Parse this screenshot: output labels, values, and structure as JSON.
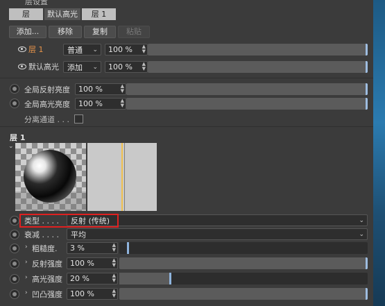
{
  "header": {
    "title": "层设置"
  },
  "tabs": [
    {
      "label": "层",
      "active": true
    },
    {
      "label": "默认高光",
      "active": false
    },
    {
      "label": "层 1",
      "active": true
    }
  ],
  "toolbar": {
    "add": "添加...",
    "remove": "移除",
    "copy": "复制",
    "paste": "粘贴"
  },
  "layers": [
    {
      "name": "层 1",
      "blend": "普通",
      "opacity": "100 %",
      "name_color": "#e8944a"
    },
    {
      "name": "默认高光",
      "blend": "添加",
      "opacity": "100 %",
      "name_color": "#d6d6d6"
    }
  ],
  "global": {
    "reflect_label": "全局反射亮度",
    "reflect_value": "100 %",
    "specular_label": "全局高光亮度",
    "specular_value": "100 %",
    "separate_label": "分离通道 . . ."
  },
  "section": {
    "title": "层 1"
  },
  "props": {
    "type_label": "类型 . . . .",
    "type_value": "反射 (传统)",
    "falloff_label": "衰减 . . . .",
    "falloff_value": "平均",
    "roughness_label": "粗糙度.",
    "roughness_value": "3 %",
    "roughness_fraction": 0.03,
    "reflect_label": "反射强度",
    "reflect_value": "100 %",
    "reflect_fraction": 1.0,
    "spec_label": "高光强度",
    "spec_value": "20 %",
    "spec_fraction": 0.2,
    "bump_label": "凹凸强度",
    "bump_value": "100 %",
    "bump_fraction": 1.0
  },
  "icons": {
    "eye": "eye-icon",
    "chevron": "chevron-down-icon",
    "arrow": "chevron-right-icon"
  },
  "colors": {
    "highlight_box": "#e02020",
    "accent_knob": "#8fb4dd"
  }
}
